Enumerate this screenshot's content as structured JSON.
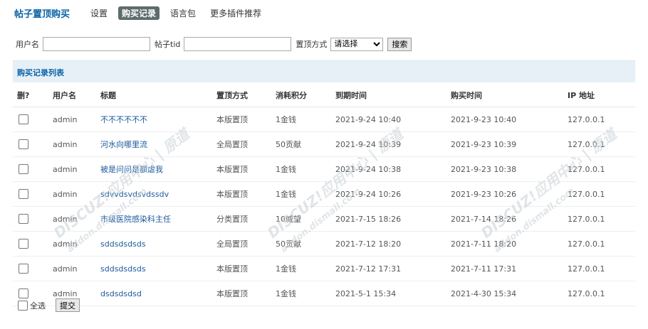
{
  "nav": {
    "title": "帖子置顶购买",
    "tabs": [
      "设置",
      "购买记录",
      "语言包",
      "更多插件推荐"
    ],
    "active_index": 1
  },
  "search": {
    "username_label": "用户名",
    "tid_label": "帖子tid",
    "method_label": "置顶方式",
    "method_selected": "请选择",
    "button": "搜索"
  },
  "section_title": "购买记录列表",
  "table": {
    "headers": [
      "删?",
      "用户名",
      "标题",
      "置顶方式",
      "消耗积分",
      "到期时间",
      "购买时间",
      "IP 地址"
    ],
    "rows": [
      {
        "user": "admin",
        "title": "不不不不不不",
        "method": "本版置顶",
        "cost": "1金钱",
        "expire": "2021-9-24 10:40",
        "buy": "2021-9-23 10:40",
        "ip": "127.0.0.1"
      },
      {
        "user": "admin",
        "title": "河水向哪里流",
        "method": "全局置顶",
        "cost": "50贡献",
        "expire": "2021-9-24 10:39",
        "buy": "2021-9-23 10:39",
        "ip": "127.0.0.1"
      },
      {
        "user": "admin",
        "title": "被是问问是额虐我",
        "method": "本版置顶",
        "cost": "1金钱",
        "expire": "2021-9-24 10:38",
        "buy": "2021-9-23 10:38",
        "ip": "127.0.0.1"
      },
      {
        "user": "admin",
        "title": "sdvvdsvdsvdssdv",
        "method": "本版置顶",
        "cost": "1金钱",
        "expire": "2021-9-24 10:26",
        "buy": "2021-9-23 10:26",
        "ip": "127.0.0.1"
      },
      {
        "user": "admin",
        "title": "市级医院感染科主任",
        "method": "分类置顶",
        "cost": "10威望",
        "expire": "2021-7-15 18:26",
        "buy": "2021-7-14 18:26",
        "ip": "127.0.0.1"
      },
      {
        "user": "admin",
        "title": "sddsdsdsds",
        "method": "全局置顶",
        "cost": "50贡献",
        "expire": "2021-7-12 18:20",
        "buy": "2021-7-11 18:20",
        "ip": "127.0.0.1"
      },
      {
        "user": "admin",
        "title": "sddsdsdsds",
        "method": "本版置顶",
        "cost": "1金钱",
        "expire": "2021-7-12 17:31",
        "buy": "2021-7-11 17:31",
        "ip": "127.0.0.1"
      },
      {
        "user": "admin",
        "title": "dsdsdsdsd",
        "method": "本版置顶",
        "cost": "1金钱",
        "expire": "2021-5-1 15:34",
        "buy": "2021-4-30 15:34",
        "ip": "127.0.0.1"
      }
    ]
  },
  "footer": {
    "select_all": "全选",
    "submit": "提交"
  },
  "watermark": "DISCUZ!应用中心 | 原道",
  "watermark_sub": "addon.dismall.com"
}
